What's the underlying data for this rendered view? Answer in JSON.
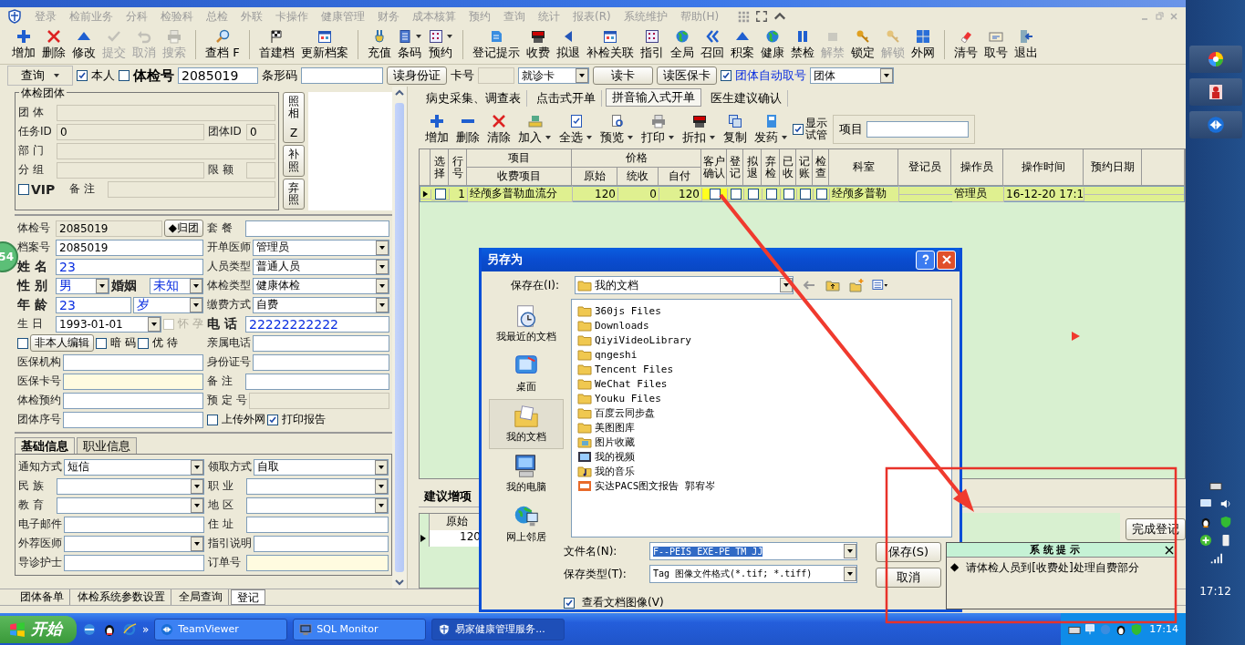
{
  "menu_bar": {
    "items": [
      "登录",
      "检前业务",
      "分科",
      "检验科",
      "总检",
      "外联",
      "卡操作",
      "健康管理",
      "财务",
      "成本核算",
      "预约",
      "查询",
      "统计",
      "报表(R)",
      "系统维护",
      "帮助(H)"
    ]
  },
  "toolbar": {
    "groups": [
      [
        {
          "label": "增加",
          "disabled": false
        },
        {
          "label": "删除",
          "disabled": false
        },
        {
          "label": "修改",
          "disabled": false
        },
        {
          "label": "提交",
          "disabled": true
        },
        {
          "label": "取消",
          "disabled": true
        },
        {
          "label": "搜索",
          "disabled": true
        }
      ],
      [
        {
          "label": "查档 F",
          "disabled": false
        }
      ],
      [
        {
          "label": "首建档",
          "disabled": false
        },
        {
          "label": "更新档案",
          "disabled": false
        }
      ],
      [
        {
          "label": "充值",
          "disabled": false,
          "dropdown": false
        },
        {
          "label": "条码",
          "disabled": false,
          "dropdown": true
        },
        {
          "label": "预约",
          "disabled": false,
          "dropdown": true
        }
      ],
      [
        {
          "label": "登记提示",
          "disabled": false
        },
        {
          "label": "收费",
          "disabled": false
        },
        {
          "label": "拟退",
          "disabled": false
        },
        {
          "label": "补检关联",
          "disabled": false
        },
        {
          "label": "指引",
          "disabled": false
        },
        {
          "label": "全局",
          "disabled": false
        },
        {
          "label": "召回",
          "disabled": false
        },
        {
          "label": "积案",
          "disabled": false
        },
        {
          "label": "健康",
          "disabled": false
        },
        {
          "label": "禁检",
          "disabled": false
        },
        {
          "label": "解禁",
          "disabled": true
        },
        {
          "label": "锁定",
          "disabled": false
        },
        {
          "label": "解锁",
          "disabled": true
        },
        {
          "label": "外网",
          "disabled": false
        }
      ],
      [
        {
          "label": "清号",
          "disabled": false
        },
        {
          "label": "取号",
          "disabled": false
        },
        {
          "label": "退出",
          "disabled": false
        }
      ]
    ]
  },
  "search_bar": {
    "query_button": "查询",
    "self_checkbox": {
      "label": "本人",
      "checked": true
    },
    "exam_no": {
      "checked": false,
      "label": "体检号",
      "value": "2085019"
    },
    "barcode": {
      "label": "条形码"
    },
    "id_button": "读身份证",
    "card_no": {
      "label": "卡号"
    },
    "card_type": "就诊卡",
    "read_card_button": "读卡",
    "insurance_button": "读医保卡",
    "auto_group": {
      "label": "团体自动取号",
      "checked": true
    },
    "group_select": "团体"
  },
  "group_box": {
    "title": "体检团体",
    "rows": [
      {
        "left": [
          {
            "kind": "label",
            "text": "团 体"
          },
          {
            "kind": "field",
            "disabled": true
          }
        ]
      },
      {
        "left": [
          {
            "kind": "label",
            "text": "任务ID"
          },
          {
            "kind": "field",
            "value": "0",
            "disabled": true
          }
        ],
        "right": [
          {
            "kind": "label",
            "text": "团体ID"
          },
          {
            "kind": "field",
            "value": "0",
            "disabled": true
          }
        ]
      },
      {
        "left": [
          {
            "kind": "label",
            "text": "部 门"
          },
          {
            "kind": "field",
            "disabled": true
          }
        ]
      },
      {
        "left": [
          {
            "kind": "label",
            "text": "分 组"
          },
          {
            "kind": "field",
            "disabled": true
          }
        ],
        "right": [
          {
            "kind": "label",
            "text": "限 额"
          },
          {
            "kind": "field",
            "disabled": true
          }
        ]
      },
      {
        "left": [
          {
            "kind": "checkbox",
            "checked": false,
            "disabled": false
          },
          {
            "kind": "label",
            "text": "VIP",
            "bold": true
          },
          {
            "kind": "label",
            "text": "备 注"
          },
          {
            "kind": "field",
            "disabled": true
          }
        ]
      }
    ],
    "photo_buttons": [
      {
        "label": "照相",
        "hotkey": "Z"
      },
      {
        "label": "补照"
      },
      {
        "label": "弃照"
      }
    ]
  },
  "badge": "54",
  "patient_form": {
    "rows": [
      {
        "left": [
          {
            "kind": "label",
            "text": "体检号"
          },
          {
            "kind": "field",
            "value": "2085019",
            "disabled": true
          },
          {
            "kind": "button",
            "text": "◆归团"
          }
        ],
        "right": [
          {
            "kind": "label",
            "text": "套 餐"
          },
          {
            "kind": "field",
            "disabled": false
          }
        ]
      },
      {
        "left": [
          {
            "kind": "label",
            "text": "档案号"
          },
          {
            "kind": "field",
            "value": "2085019",
            "disabled": false
          }
        ],
        "right": [
          {
            "kind": "label",
            "text": "开单医师"
          },
          {
            "kind": "select",
            "value": "管理员"
          }
        ]
      },
      {
        "left": [
          {
            "kind": "label",
            "text": "姓 名",
            "bold": true
          },
          {
            "kind": "field",
            "value": "23",
            "disabled": false
          }
        ],
        "right": [
          {
            "kind": "label",
            "text": "人员类型"
          },
          {
            "kind": "select",
            "value": "普通人员"
          }
        ]
      },
      {
        "left": [
          {
            "kind": "label",
            "text": "性 别",
            "bold": true
          },
          {
            "kind": "select",
            "value": "男"
          },
          {
            "kind": "label",
            "text": "婚姻",
            "bold": true
          },
          {
            "kind": "select",
            "value": "未知"
          }
        ],
        "right": [
          {
            "kind": "label",
            "text": "体检类型"
          },
          {
            "kind": "select",
            "value": "健康体检"
          }
        ]
      },
      {
        "left": [
          {
            "kind": "label",
            "text": "年 龄",
            "bold": true
          },
          {
            "kind": "field",
            "value": "23",
            "disabled": false
          },
          {
            "kind": "select",
            "value": "岁"
          }
        ],
        "right": [
          {
            "kind": "label",
            "text": "缴费方式"
          },
          {
            "kind": "select",
            "value": "自费"
          }
        ]
      },
      {
        "left": [
          {
            "kind": "label",
            "text": "生 日"
          },
          {
            "kind": "select",
            "value": "1993-01-01"
          },
          {
            "kind": "checkbox",
            "label": "怀 孕",
            "checked": false,
            "disabled": true
          }
        ],
        "right": [
          {
            "kind": "label",
            "text": "电 话",
            "bold": true
          },
          {
            "kind": "field",
            "value": "22222222222",
            "disabled": false
          }
        ]
      },
      {
        "left": [
          {
            "kind": "checkbox",
            "checked": false,
            "disabled": false
          },
          {
            "kind": "button",
            "text": "非本人编辑"
          },
          {
            "kind": "checkbox",
            "label": "暗 码",
            "checked": false,
            "disabled": false
          },
          {
            "kind": "checkbox",
            "label": "优 待",
            "checked": false,
            "disabled": false
          }
        ],
        "right": [
          {
            "kind": "label",
            "text": "亲属电话"
          },
          {
            "kind": "field",
            "disabled": false
          }
        ]
      },
      {
        "left": [
          {
            "kind": "label",
            "text": "医保机构"
          },
          {
            "kind": "field",
            "disabled": false
          }
        ],
        "right": [
          {
            "kind": "label",
            "text": "身份证号"
          },
          {
            "kind": "field",
            "disabled": false
          }
        ]
      },
      {
        "left": [
          {
            "kind": "label",
            "text": "医保卡号"
          },
          {
            "kind": "field",
            "disabled": false
          }
        ],
        "right": [
          {
            "kind": "label",
            "text": "备 注"
          },
          {
            "kind": "field",
            "disabled": false
          }
        ]
      },
      {
        "left": [
          {
            "kind": "label",
            "text": "体检预约"
          },
          {
            "kind": "field",
            "disabled": false
          }
        ],
        "right": [
          {
            "kind": "label",
            "text": "预 定 号"
          },
          {
            "kind": "field",
            "disabled": true
          }
        ]
      },
      {
        "left": [
          {
            "kind": "label",
            "text": "团体序号"
          },
          {
            "kind": "field",
            "disabled": false
          }
        ],
        "right": [
          {
            "kind": "checkbox",
            "label": "上传外网",
            "checked": false,
            "disabled": false
          },
          {
            "kind": "checkbox",
            "label": "打印报告",
            "checked": true,
            "disabled": false
          }
        ]
      }
    ]
  },
  "basic_info": {
    "tabs": [
      {
        "label": "基础信息",
        "selected": true
      },
      {
        "label": "职业信息",
        "selected": false
      }
    ],
    "rows": [
      {
        "left": [
          {
            "kind": "label",
            "text": "通知方式"
          },
          {
            "kind": "select",
            "value": "短信"
          }
        ],
        "right": [
          {
            "kind": "label",
            "text": "领取方式"
          },
          {
            "kind": "select",
            "value": "自取"
          }
        ]
      },
      {
        "left": [
          {
            "kind": "label",
            "text": "民 族"
          },
          {
            "kind": "select"
          }
        ],
        "right": [
          {
            "kind": "label",
            "text": "职 业"
          },
          {
            "kind": "select"
          }
        ]
      },
      {
        "left": [
          {
            "kind": "label",
            "text": "教 育"
          },
          {
            "kind": "select"
          }
        ],
        "right": [
          {
            "kind": "label",
            "text": "地 区"
          },
          {
            "kind": "select"
          }
        ]
      },
      {
        "left": [
          {
            "kind": "label",
            "text": "电子邮件"
          },
          {
            "kind": "field",
            "disabled": false
          }
        ],
        "right": [
          {
            "kind": "label",
            "text": "住 址"
          },
          {
            "kind": "field",
            "disabled": false
          }
        ]
      },
      {
        "left": [
          {
            "kind": "label",
            "text": "外荐医师"
          },
          {
            "kind": "select"
          }
        ],
        "right": [
          {
            "kind": "label",
            "text": "指引说明"
          },
          {
            "kind": "field",
            "disabled": false
          }
        ]
      },
      {
        "left": [
          {
            "kind": "label",
            "text": "导诊护士"
          },
          {
            "kind": "field",
            "disabled": false
          }
        ],
        "right": [
          {
            "kind": "label",
            "text": "订单号"
          },
          {
            "kind": "field",
            "disabled": false
          }
        ]
      }
    ]
  },
  "order_tabs": [
    {
      "label": "病史采集、调查表",
      "selected": false
    },
    {
      "label": "点击式开单",
      "selected": false
    },
    {
      "label": "拼音输入式开单",
      "selected": true
    },
    {
      "label": "医生建议确认",
      "selected": false
    }
  ],
  "order_toolbar": {
    "items": [
      {
        "label": "增加",
        "dropdown": false
      },
      {
        "label": "删除",
        "dropdown": false
      },
      {
        "label": "清除",
        "dropdown": false
      },
      {
        "label": "加入",
        "dropdown": true
      },
      {
        "label": "全选",
        "dropdown": true
      },
      {
        "label": "预览",
        "dropdown": true
      },
      {
        "label": "打印",
        "dropdown": true
      },
      {
        "label": "折扣",
        "dropdown": true
      },
      {
        "label": "复制",
        "dropdown": false
      },
      {
        "label": "发药",
        "dropdown": true
      }
    ],
    "tube_checkbox": {
      "label": "显示试管",
      "checked": true
    },
    "item_field": {
      "label": "项目"
    }
  },
  "record_table": {
    "columns": [
      {
        "label": "选择"
      },
      {
        "label": "行号"
      },
      {
        "label": "收费项目",
        "group": "项目"
      },
      {
        "label": "原始",
        "group": "价格"
      },
      {
        "label": "统收",
        "grouped": true
      },
      {
        "label": "自付",
        "grouped": true
      },
      {
        "label": "客户确认"
      },
      {
        "label": "登记"
      },
      {
        "label": "拟退"
      },
      {
        "label": "弃检"
      },
      {
        "label": "已收"
      },
      {
        "label": "记账"
      },
      {
        "label": "检查"
      },
      {
        "label": "科室"
      },
      {
        "label": "登记员"
      },
      {
        "label": "操作员"
      },
      {
        "label": "操作时间"
      },
      {
        "label": "预约日期"
      }
    ],
    "rows": [
      {
        "selected": true,
        "cells": [
          {
            "kind": "check",
            "checked": false
          },
          {
            "kind": "number",
            "text": "1"
          },
          {
            "kind": "text",
            "text": "经颅多普勒血流分"
          },
          {
            "kind": "number",
            "text": "120"
          },
          {
            "kind": "number",
            "text": "0"
          },
          {
            "kind": "number",
            "text": "120"
          },
          {
            "kind": "check",
            "checked": false
          },
          {
            "kind": "check",
            "checked": false
          },
          {
            "kind": "check",
            "checked": false
          },
          {
            "kind": "check",
            "checked": false
          },
          {
            "kind": "check",
            "checked": false
          },
          {
            "kind": "check",
            "checked": false
          },
          {
            "kind": "check",
            "checked": false
          },
          {
            "kind": "text",
            "text": "经颅多普勒"
          },
          {
            "kind": "empty"
          },
          {
            "kind": "text",
            "text": "管理员"
          },
          {
            "kind": "text",
            "text": "16-12-20 17:1"
          },
          {
            "kind": "empty"
          }
        ]
      }
    ]
  },
  "suggestion": {
    "tab": "建议增项",
    "column": "原始",
    "value": "120",
    "finish_button": "完成登记"
  },
  "bottom_tabs": [
    {
      "label": "团体备单",
      "selected": false
    },
    {
      "label": "体检系统参数设置",
      "selected": false
    },
    {
      "label": "全局查询",
      "selected": false
    },
    {
      "label": "登记",
      "selected": true
    }
  ],
  "save_dialog": {
    "title": "另存为",
    "save_in_label": "保存在(I):",
    "save_in": "我的文档",
    "places": [
      {
        "label": "我最近的文档",
        "selected": false
      },
      {
        "label": "桌面",
        "selected": false
      },
      {
        "label": "我的文档",
        "selected": true
      },
      {
        "label": "我的电脑",
        "selected": false
      },
      {
        "label": "网上邻居",
        "selected": false
      }
    ],
    "files": [
      {
        "name": "360js Files",
        "kind": "folder"
      },
      {
        "name": "Downloads",
        "kind": "folder"
      },
      {
        "name": "QiyiVideoLibrary",
        "kind": "folder"
      },
      {
        "name": "qngeshi",
        "kind": "folder"
      },
      {
        "name": "Tencent Files",
        "kind": "folder"
      },
      {
        "name": "WeChat Files",
        "kind": "folder"
      },
      {
        "name": "Youku Files",
        "kind": "folder"
      },
      {
        "name": "百度云同步盘",
        "kind": "folder"
      },
      {
        "name": "美图图库",
        "kind": "folder"
      },
      {
        "name": "图片收藏",
        "kind": "pictures"
      },
      {
        "name": "我的视频",
        "kind": "video"
      },
      {
        "name": "我的音乐",
        "kind": "music"
      },
      {
        "name": "实达PACS图文报告 郭宥岑",
        "kind": "image"
      }
    ],
    "filename_label": "文件名(N):",
    "filename": "F--PEIS_EXE-PE_TM_JJ",
    "filetype_label": "保存类型(T):",
    "filetype": "Tag 图像文件格式(*.tif; *.tiff)",
    "save_button": "保存(S)",
    "cancel_button": "取消",
    "preview_checkbox": {
      "label": "查看文档图像(V)",
      "checked": true
    }
  },
  "system_prompt": {
    "title": "系 统 提 示",
    "bullet": "◆",
    "message": "请体检人员到[收费处]处理自费部分"
  },
  "taskbar": {
    "start": "开始",
    "overflow": "»",
    "tasks": [
      {
        "label": "TeamViewer",
        "active": false
      },
      {
        "label": "SQL Monitor",
        "active": false
      },
      {
        "label": "易家健康管理服务...",
        "active": true
      }
    ],
    "clock": "17:14"
  },
  "side_bar": {
    "clock": "17:12"
  }
}
